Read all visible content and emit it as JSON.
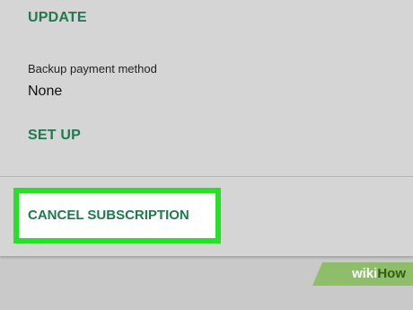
{
  "payment": {
    "update_label": "UPDATE",
    "backup_label": "Backup payment method",
    "backup_value": "None",
    "setup_label": "SET UP"
  },
  "subscription": {
    "cancel_label": "CANCEL SUBSCRIPTION"
  },
  "watermark": {
    "wiki": "wiki",
    "how": "How"
  },
  "colors": {
    "accent": "#1e7a4d",
    "highlight": "#28e027",
    "background": "#d5d5d5"
  }
}
